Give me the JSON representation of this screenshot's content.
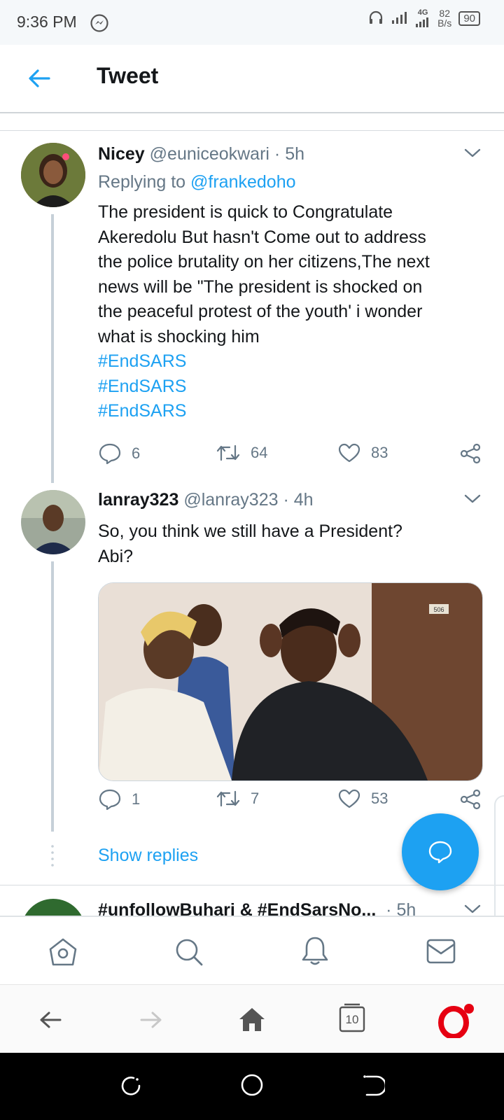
{
  "status_bar": {
    "time": "9:36 PM",
    "network": "4G",
    "speed_value": "82",
    "speed_unit": "B/s",
    "battery": "90"
  },
  "header": {
    "title": "Tweet"
  },
  "tweets": [
    {
      "name": "Nicey",
      "handle": "@euniceokwari",
      "time": "5h",
      "replying_prefix": "Replying to",
      "replying_handle": "@frankedoho",
      "body_lines": [
        "The president is quick to Congratulate",
        "Akeredolu But hasn't Come out to address",
        "the police brutality on her citizens,The next",
        "news will be \"The president is shocked on",
        "the peaceful protest of the youth' i wonder",
        "what is shocking him"
      ],
      "hashtags": [
        "#EndSARS",
        "#EndSARS",
        "#EndSARS"
      ],
      "replies": "6",
      "retweets": "64",
      "likes": "83"
    },
    {
      "name": "lanray323",
      "handle": "@lanray323",
      "time": "4h",
      "body_lines": [
        "So, you think we still have a President?",
        "Abi?"
      ],
      "replies": "1",
      "retweets": "7",
      "likes": "53"
    },
    {
      "name": "#unfollowBuhari & #EndSarsNo...",
      "time": "5h"
    }
  ],
  "show_replies": "Show replies",
  "media": {
    "door_number": "506"
  },
  "browser": {
    "tabs_count": "10"
  },
  "colors": {
    "accent": "#1da1f2",
    "text": "#14171a",
    "muted": "#657786",
    "opera": "#e60012"
  },
  "icons": {
    "back": "arrow-left-icon",
    "chevron": "chevron-down-icon",
    "reply": "comment-bubble-icon",
    "retweet": "retweet-icon",
    "like": "heart-icon",
    "share": "share-icon",
    "home": "home-icon",
    "search": "search-icon",
    "notifications": "bell-icon",
    "messages": "envelope-icon",
    "compose": "compose-reply-icon"
  }
}
